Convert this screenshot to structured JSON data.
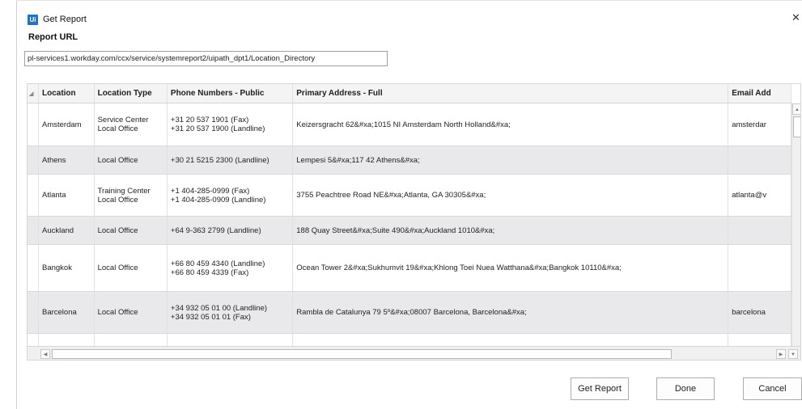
{
  "dialog": {
    "app_icon_text": "Ui",
    "title": "Get Report",
    "close_glyph": "✕"
  },
  "report_url": {
    "label": "Report URL",
    "value": "pl-services1.workday.com/ccx/service/systemreport2/uipath_dpt1/Location_Directory"
  },
  "table": {
    "sort_glyph": "◢",
    "columns": [
      "Location",
      "Location Type",
      "Phone Numbers - Public",
      "Primary Address - Full",
      "Email Add"
    ],
    "rows": [
      {
        "location": "Amsterdam",
        "location_type": [
          "Service Center",
          "Local Office"
        ],
        "phones": [
          "+31 20 537 1901 (Fax)",
          "+31 20 537 1900 (Landline)"
        ],
        "address": "Keizersgracht 62&#xa;1015 NI Amsterdam North Holland&#xa;",
        "email": "amsterdar"
      },
      {
        "location": "Athens",
        "location_type": [
          "Local Office"
        ],
        "phones": [
          "+30 21 5215 2300 (Landline)"
        ],
        "address": "Lempesi 5&#xa;117 42 Athens&#xa;",
        "email": ""
      },
      {
        "location": "Atlanta",
        "location_type": [
          "Training Center",
          "Local Office"
        ],
        "phones": [
          "+1 404-285-0999 (Fax)",
          "+1 404-285-0909 (Landline)"
        ],
        "address": "3755 Peachtree Road NE&#xa;Atlanta, GA 30305&#xa;",
        "email": "atlanta@v"
      },
      {
        "location": "Auckland",
        "location_type": [
          "Local Office"
        ],
        "phones": [
          "+64 9-363 2799 (Landline)"
        ],
        "address": "188 Quay Street&#xa;Suite 490&#xa;Auckland 1010&#xa;",
        "email": ""
      },
      {
        "location": "Bangkok",
        "location_type": [
          "Local Office"
        ],
        "phones": [
          "+66 80 459 4340 (Landline)",
          "+66 80 459 4339 (Fax)"
        ],
        "address": "Ocean Tower 2&#xa;Sukhumvit 19&#xa;Khlong Toei Nuea Watthana&#xa;Bangkok 10110&#xa;",
        "email": ""
      },
      {
        "location": "Barcelona",
        "location_type": [
          "Local Office"
        ],
        "phones": [
          "+34 932 05 01 00 (Landline)",
          "+34 932 05 01 01 (Fax)"
        ],
        "address": "Rambla de Catalunya 79   5º&#xa;08007 Barcelona, Barcelona&#xa;",
        "email": "barcelona"
      }
    ]
  },
  "scrollbars": {
    "up_glyph": "▲",
    "left_glyph": "◀",
    "right_glyph": "▶",
    "down_glyph": "▼"
  },
  "buttons": {
    "get_report": "Get Report",
    "done": "Done",
    "cancel": "Cancel"
  }
}
